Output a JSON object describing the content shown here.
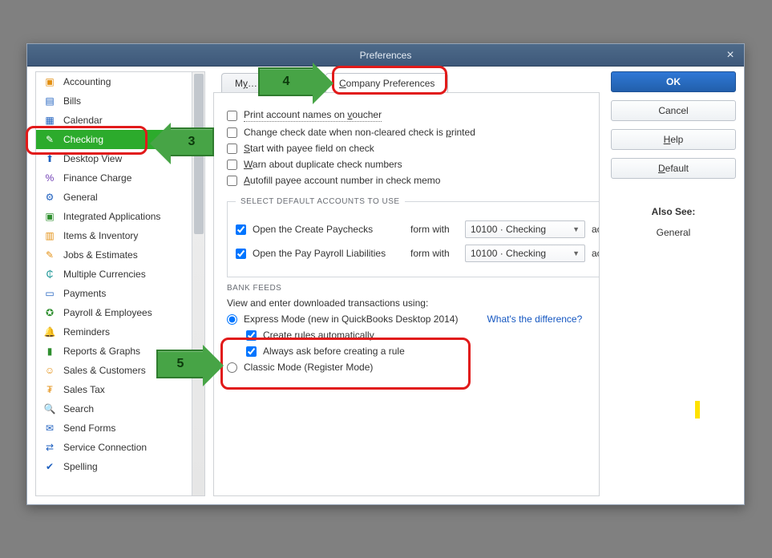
{
  "dialog": {
    "title": "Preferences"
  },
  "sidebar": {
    "items": [
      {
        "label": "Accounting",
        "icon": "coins",
        "color": "orange"
      },
      {
        "label": "Bills",
        "icon": "calendar-bill",
        "color": "blue"
      },
      {
        "label": "Calendar",
        "icon": "calendar",
        "color": "blue"
      },
      {
        "label": "Checking",
        "icon": "check",
        "color": "green",
        "selected": true
      },
      {
        "label": "Desktop View",
        "icon": "arrow-up",
        "color": "blue"
      },
      {
        "label": "Finance Charge",
        "icon": "percent",
        "color": "purple"
      },
      {
        "label": "General",
        "icon": "gear",
        "color": "blue"
      },
      {
        "label": "Integrated Applications",
        "icon": "apps",
        "color": "green"
      },
      {
        "label": "Items & Inventory",
        "icon": "boxes",
        "color": "orange"
      },
      {
        "label": "Jobs & Estimates",
        "icon": "pencil",
        "color": "orange"
      },
      {
        "label": "Multiple Currencies",
        "icon": "currencies",
        "color": "teal"
      },
      {
        "label": "Payments",
        "icon": "card",
        "color": "blue"
      },
      {
        "label": "Payroll & Employees",
        "icon": "payroll",
        "color": "green"
      },
      {
        "label": "Reminders",
        "icon": "bell",
        "color": "orange"
      },
      {
        "label": "Reports & Graphs",
        "icon": "chart",
        "color": "green"
      },
      {
        "label": "Sales & Customers",
        "icon": "customers",
        "color": "orange"
      },
      {
        "label": "Sales Tax",
        "icon": "tax",
        "color": "orange"
      },
      {
        "label": "Search",
        "icon": "search",
        "color": "blue"
      },
      {
        "label": "Send Forms",
        "icon": "send",
        "color": "blue"
      },
      {
        "label": "Service Connection",
        "icon": "service",
        "color": "blue"
      },
      {
        "label": "Spelling",
        "icon": "spell",
        "color": "blue"
      }
    ]
  },
  "tabs": {
    "my": {
      "label_before": "M",
      "label_after": "…",
      "underline": "y"
    },
    "company": {
      "label_before": "",
      "label_after": "ompany Preferences",
      "underline": "C"
    }
  },
  "buttons": {
    "ok": "OK",
    "cancel": "Cancel",
    "help_before": "",
    "help_u": "H",
    "help_after": "elp",
    "default_before": "",
    "default_u": "D",
    "default_after": "efault"
  },
  "also": {
    "heading": "Also See:",
    "item1": "General"
  },
  "form": {
    "cb_print_before": "Print account names on ",
    "cb_print_u": "v",
    "cb_print_after": "oucher",
    "cb_changeDate_before": "Change check date when non-cleared check is ",
    "cb_changeDate_u": "p",
    "cb_changeDate_after": "rinted",
    "cb_startPayee_before": "",
    "cb_startPayee_u": "S",
    "cb_startPayee_after": "tart with payee field on check",
    "cb_warnDup_before": "",
    "cb_warnDup_u": "W",
    "cb_warnDup_after": "arn about duplicate check numbers",
    "cb_autofill_before": "",
    "cb_autofill_u": "A",
    "cb_autofill_after": "utofill payee account number in check memo",
    "group_defaults_title": "SELECT DEFAULT ACCOUNTS TO USE",
    "row_paychecks": {
      "label": "Open the Create Paychecks",
      "with": "form with",
      "account": "account",
      "value": "10100 · Checking"
    },
    "row_liabilities": {
      "label": "Open the Pay Payroll Liabilities",
      "with": "form with",
      "account": "account",
      "value": "10100 · Checking"
    },
    "bank_feeds_title": "BANK FEEDS",
    "bank_view_label": "View and enter downloaded transactions using:",
    "rd_express": "Express Mode (new in QuickBooks Desktop 2014)",
    "link_whats_difference": "What's the difference?",
    "cb_createRules": "Create rules automatically",
    "cb_alwaysAsk": "Always ask before creating a rule",
    "rd_classic": "Classic Mode (Register Mode)"
  },
  "callouts": {
    "n3": "3",
    "n4": "4",
    "n5": "5"
  }
}
